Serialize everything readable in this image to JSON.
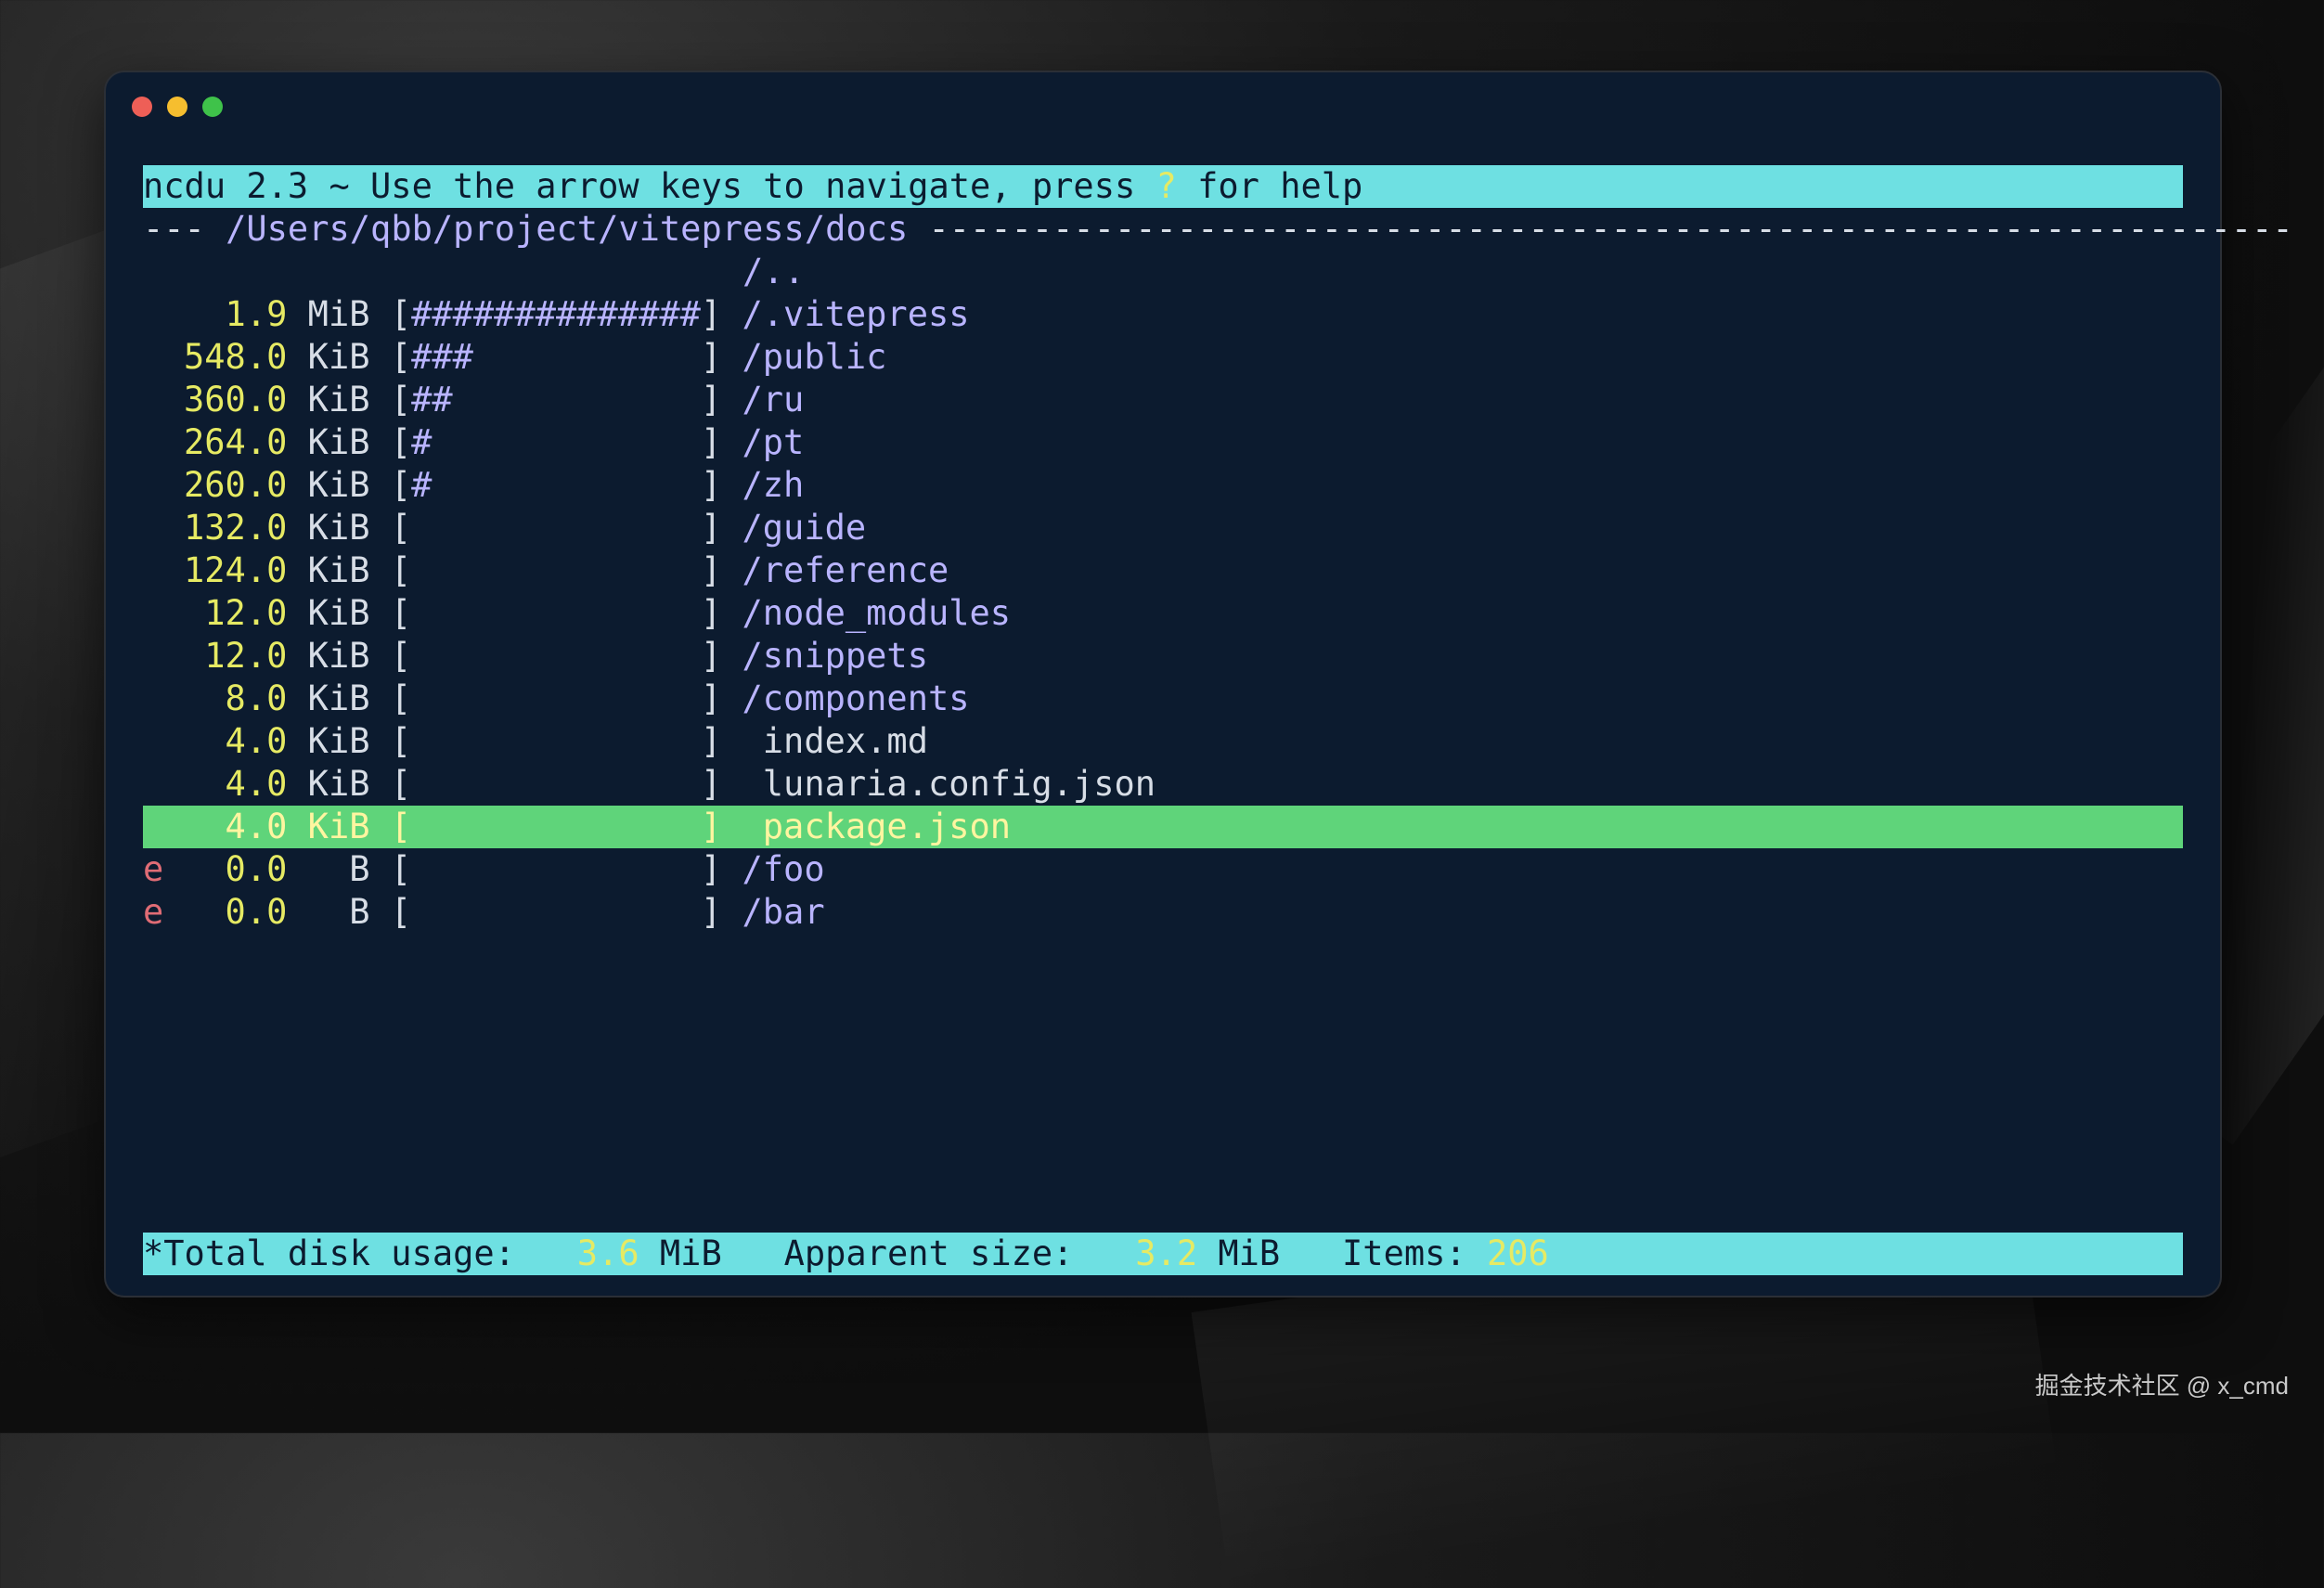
{
  "header": {
    "prefix": "ncdu 2.3 ~ Use the arrow keys to navigate, press ",
    "key": "?",
    "suffix": " for help"
  },
  "path": {
    "lead": "--- ",
    "dir": "/Users/qbb/project/vitepress/docs",
    "trail": " ------------------------------------------------------------------"
  },
  "parent_entry": "/..",
  "rows": [
    {
      "flag": "",
      "size": "1.9",
      "unit": "MiB",
      "bar": "##############",
      "name": "/.vitepress",
      "kind": "dir"
    },
    {
      "flag": "",
      "size": "548.0",
      "unit": "KiB",
      "bar": "###",
      "name": "/public",
      "kind": "dir"
    },
    {
      "flag": "",
      "size": "360.0",
      "unit": "KiB",
      "bar": "##",
      "name": "/ru",
      "kind": "dir"
    },
    {
      "flag": "",
      "size": "264.0",
      "unit": "KiB",
      "bar": "#",
      "name": "/pt",
      "kind": "dir"
    },
    {
      "flag": "",
      "size": "260.0",
      "unit": "KiB",
      "bar": "#",
      "name": "/zh",
      "kind": "dir"
    },
    {
      "flag": "",
      "size": "132.0",
      "unit": "KiB",
      "bar": "",
      "name": "/guide",
      "kind": "dir"
    },
    {
      "flag": "",
      "size": "124.0",
      "unit": "KiB",
      "bar": "",
      "name": "/reference",
      "kind": "dir"
    },
    {
      "flag": "",
      "size": "12.0",
      "unit": "KiB",
      "bar": "",
      "name": "/node_modules",
      "kind": "dir"
    },
    {
      "flag": "",
      "size": "12.0",
      "unit": "KiB",
      "bar": "",
      "name": "/snippets",
      "kind": "dir"
    },
    {
      "flag": "",
      "size": "8.0",
      "unit": "KiB",
      "bar": "",
      "name": "/components",
      "kind": "dir"
    },
    {
      "flag": "",
      "size": "4.0",
      "unit": "KiB",
      "bar": "",
      "name": "index.md",
      "kind": "file"
    },
    {
      "flag": "",
      "size": "4.0",
      "unit": "KiB",
      "bar": "",
      "name": "lunaria.config.json",
      "kind": "file"
    },
    {
      "flag": "",
      "size": "4.0",
      "unit": "KiB",
      "bar": "",
      "name": "package.json",
      "kind": "file",
      "selected": true
    },
    {
      "flag": "e",
      "size": "0.0",
      "unit": "B",
      "bar": "",
      "name": "/foo",
      "kind": "dir"
    },
    {
      "flag": "e",
      "size": "0.0",
      "unit": "B",
      "bar": "",
      "name": "/bar",
      "kind": "dir"
    }
  ],
  "status": {
    "total_label": "*Total disk usage:",
    "total_value": "3.6",
    "total_unit": "MiB",
    "apparent_label": "Apparent size:",
    "apparent_value": "3.2",
    "apparent_unit": "MiB",
    "items_label": "Items:",
    "items_value": "206"
  },
  "watermark": "掘金技术社区 @ x_cmd"
}
